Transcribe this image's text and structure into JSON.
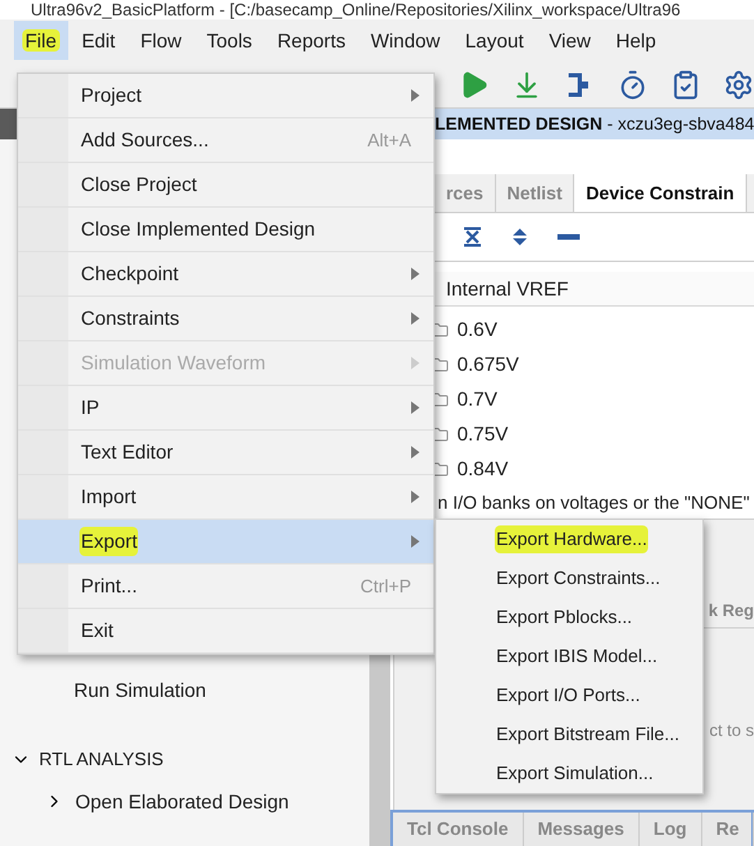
{
  "window": {
    "title": "Ultra96v2_BasicPlatform - [C:/basecamp_Online/Repositories/Xilinx_workspace/Ultra96"
  },
  "menubar": [
    {
      "label": "File",
      "selected": true,
      "highlighted": true
    },
    {
      "label": "Edit",
      "selected": false,
      "highlighted": false
    },
    {
      "label": "Flow",
      "selected": false,
      "highlighted": false
    },
    {
      "label": "Tools",
      "selected": false,
      "highlighted": false
    },
    {
      "label": "Reports",
      "selected": false,
      "highlighted": false
    },
    {
      "label": "Window",
      "selected": false,
      "highlighted": false
    },
    {
      "label": "Layout",
      "selected": false,
      "highlighted": false
    },
    {
      "label": "View",
      "selected": false,
      "highlighted": false
    },
    {
      "label": "Help",
      "selected": false,
      "highlighted": false
    }
  ],
  "toolbar": [
    {
      "kind": "run"
    },
    {
      "kind": "download"
    },
    {
      "kind": "route"
    },
    {
      "kind": "timer"
    },
    {
      "kind": "clipboard"
    },
    {
      "kind": "gear"
    }
  ],
  "flow_navigator": {
    "items": [
      {
        "kind": "task",
        "label": "Run Simulation"
      },
      {
        "kind": "section",
        "label": "RTL ANALYSIS",
        "expanded": true
      },
      {
        "kind": "subsection",
        "label": "Open Elaborated Design",
        "expanded": false
      }
    ]
  },
  "design_panel": {
    "header": "LEMENTED DESIGN",
    "part": " - xczu3eg-sbva484",
    "tabs": [
      {
        "label": "rces",
        "selected": false
      },
      {
        "label": "Netlist",
        "selected": false
      },
      {
        "label": "Device Constrain",
        "selected": true
      }
    ],
    "column": "Internal VREF",
    "rows": [
      "0.6V",
      "0.675V",
      "0.7V",
      "0.75V",
      "0.84V"
    ],
    "note": "n I/O banks on voltages or the \"NONE\"",
    "lower_tab": "k Reg",
    "lower_text": "ct to s"
  },
  "console_tabs": [
    {
      "label": "Tcl Console",
      "selected": false
    },
    {
      "label": "Messages",
      "selected": false
    },
    {
      "label": "Log",
      "selected": false
    },
    {
      "label": "Re",
      "selected": false
    }
  ],
  "file_menu": [
    {
      "label": "Project",
      "submenu": true,
      "disabled": false,
      "selected": false,
      "highlighted": false
    },
    {
      "label": "Add Sources...",
      "shortcut": "Alt+A",
      "submenu": false,
      "disabled": false,
      "selected": false,
      "highlighted": false
    },
    {
      "label": "Close Project",
      "submenu": false,
      "disabled": false,
      "selected": false,
      "highlighted": false
    },
    {
      "label": "Close Implemented Design",
      "submenu": false,
      "disabled": false,
      "selected": false,
      "highlighted": false
    },
    {
      "label": "Checkpoint",
      "submenu": true,
      "disabled": false,
      "selected": false,
      "highlighted": false
    },
    {
      "label": "Constraints",
      "submenu": true,
      "disabled": false,
      "selected": false,
      "highlighted": false
    },
    {
      "label": "Simulation Waveform",
      "submenu": true,
      "disabled": true,
      "selected": false,
      "highlighted": false
    },
    {
      "label": "IP",
      "submenu": true,
      "disabled": false,
      "selected": false,
      "highlighted": false
    },
    {
      "label": "Text Editor",
      "submenu": true,
      "disabled": false,
      "selected": false,
      "highlighted": false
    },
    {
      "label": "Import",
      "submenu": true,
      "disabled": false,
      "selected": false,
      "highlighted": false
    },
    {
      "label": "Export",
      "submenu": true,
      "disabled": false,
      "selected": true,
      "highlighted": true
    },
    {
      "label": "Print...",
      "shortcut": "Ctrl+P",
      "submenu": false,
      "disabled": false,
      "selected": false,
      "highlighted": false
    },
    {
      "label": "Exit",
      "submenu": false,
      "disabled": false,
      "selected": false,
      "highlighted": false
    }
  ],
  "export_menu": [
    {
      "label": "Export Hardware...",
      "highlighted": true
    },
    {
      "label": "Export Constraints...",
      "highlighted": false
    },
    {
      "label": "Export Pblocks...",
      "highlighted": false
    },
    {
      "label": "Export IBIS Model...",
      "highlighted": false
    },
    {
      "label": "Export I/O Ports...",
      "highlighted": false
    },
    {
      "label": "Export Bitstream File...",
      "highlighted": false
    },
    {
      "label": "Export Simulation...",
      "highlighted": false
    }
  ]
}
